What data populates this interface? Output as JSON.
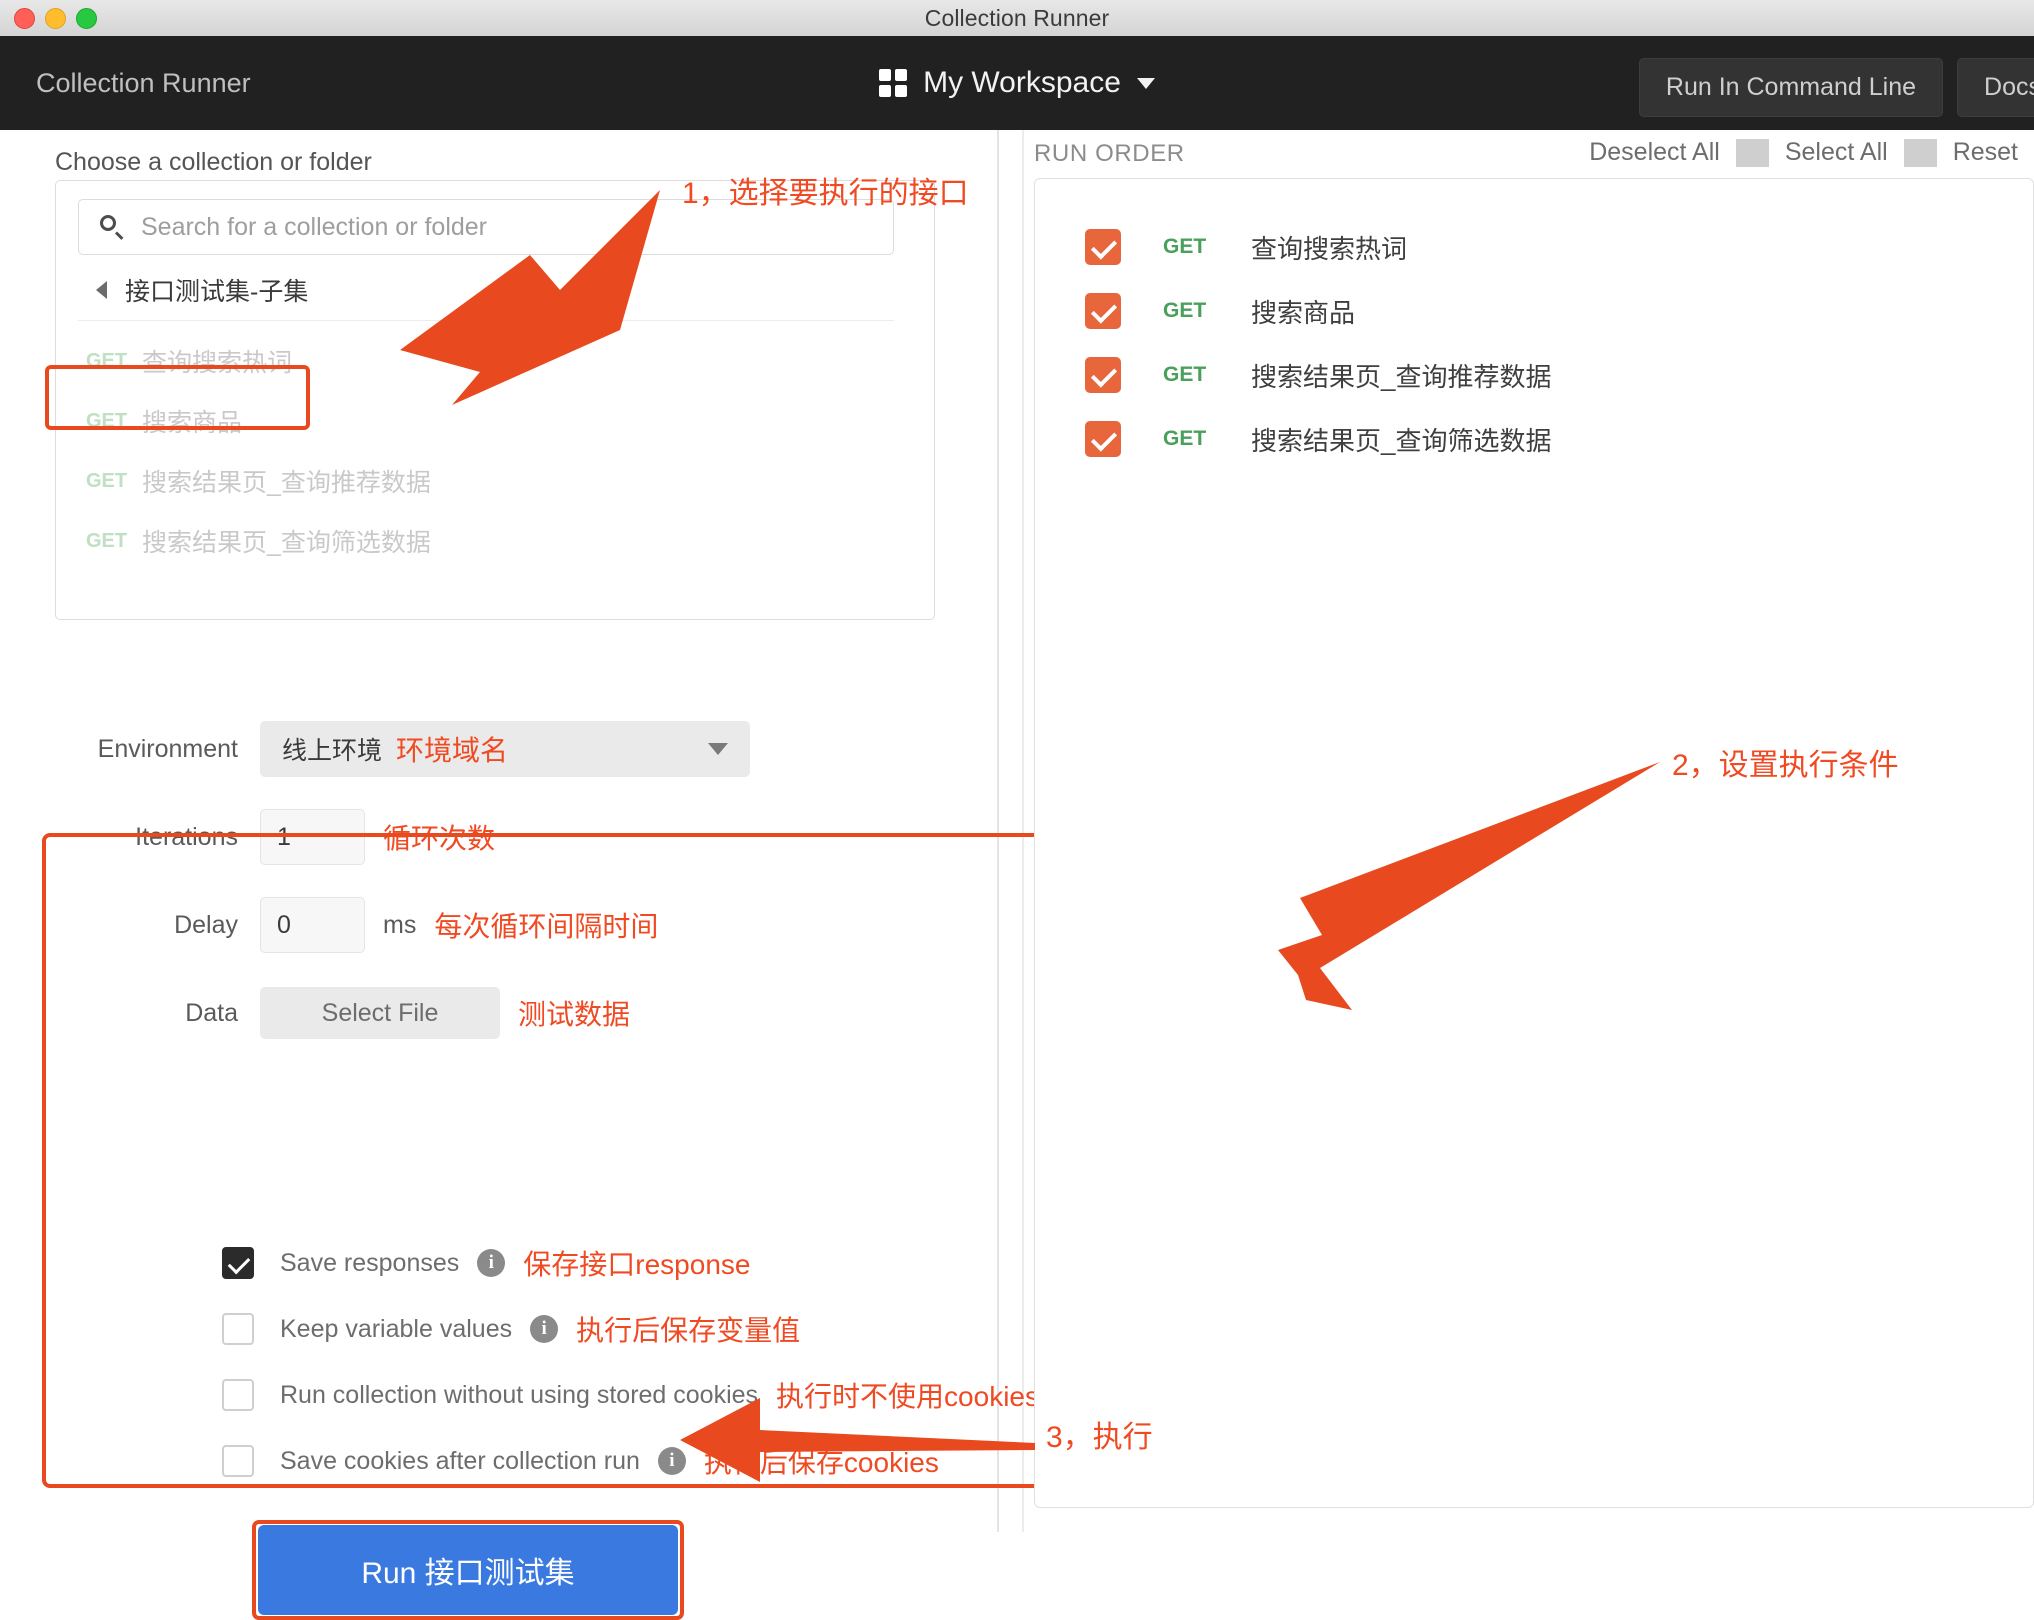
{
  "window": {
    "title": "Collection Runner",
    "traffic_lights": [
      "close-red",
      "minimize-yellow",
      "maximize-green"
    ]
  },
  "navbar": {
    "brand": "Collection Runner",
    "workspace_icon": "grid-icon",
    "workspace": "My Workspace",
    "workspace_caret": "chevron-down-icon",
    "buttons": [
      {
        "label": "Run In Command Line"
      },
      {
        "label": "Docs"
      }
    ]
  },
  "left_panel": {
    "choose_label": "Choose a collection or folder",
    "search": {
      "icon": "search-icon",
      "placeholder": "Search for a collection or folder",
      "value": ""
    },
    "collection": {
      "arrow_icon": "caret-left-icon",
      "name": "接口测试集-子集"
    },
    "requests": [
      {
        "method": "GET",
        "name": "查询搜索热词"
      },
      {
        "method": "GET",
        "name": "搜索商品"
      },
      {
        "method": "GET",
        "name": "搜索结果页_查询推荐数据"
      },
      {
        "method": "GET",
        "name": "搜索结果页_查询筛选数据"
      }
    ]
  },
  "settings": {
    "environment": {
      "label": "Environment",
      "value": "线上环境",
      "note": "环境域名",
      "caret": "chevron-down-icon"
    },
    "iterations": {
      "label": "Iterations",
      "value": "1",
      "note": "循环次数"
    },
    "delay": {
      "label": "Delay",
      "value": "0",
      "unit": "ms",
      "note": "每次循环间隔时间"
    },
    "data": {
      "label": "Data",
      "button_label": "Select File",
      "note": "测试数据"
    },
    "checkboxes": [
      {
        "label": "Save responses",
        "checked": true,
        "info": true,
        "note": "保存接口response"
      },
      {
        "label": "Keep variable values",
        "checked": false,
        "info": true,
        "note": "执行后保存变量值"
      },
      {
        "label": "Run collection without using stored cookies",
        "checked": false,
        "info": false,
        "note": "执行时不使用cookies管理器"
      },
      {
        "label": "Save cookies after collection run",
        "checked": false,
        "info": true,
        "note": "执行后保存cookies"
      }
    ]
  },
  "run_button": {
    "label": "Run 接口测试集"
  },
  "run_order": {
    "title": "RUN ORDER",
    "actions": [
      "Deselect All",
      "Select All",
      "Reset"
    ],
    "items": [
      {
        "checked": true,
        "method": "GET",
        "name": "查询搜索热词"
      },
      {
        "checked": true,
        "method": "GET",
        "name": "搜索商品"
      },
      {
        "checked": true,
        "method": "GET",
        "name": "搜索结果页_查询推荐数据"
      },
      {
        "checked": true,
        "method": "GET",
        "name": "搜索结果页_查询筛选数据"
      }
    ]
  },
  "annotations": {
    "step1": "1，选择要执行的接口",
    "step2": "2，设置执行条件",
    "step3": "3，执行"
  },
  "colors": {
    "annotation_orange": "#f04a22",
    "highlight_box": "#e8491f",
    "run_button_blue": "#3a7ae0",
    "checkbox_orange": "#e8663c",
    "get_green": "#49a05a",
    "navbar_dark": "#212121"
  }
}
